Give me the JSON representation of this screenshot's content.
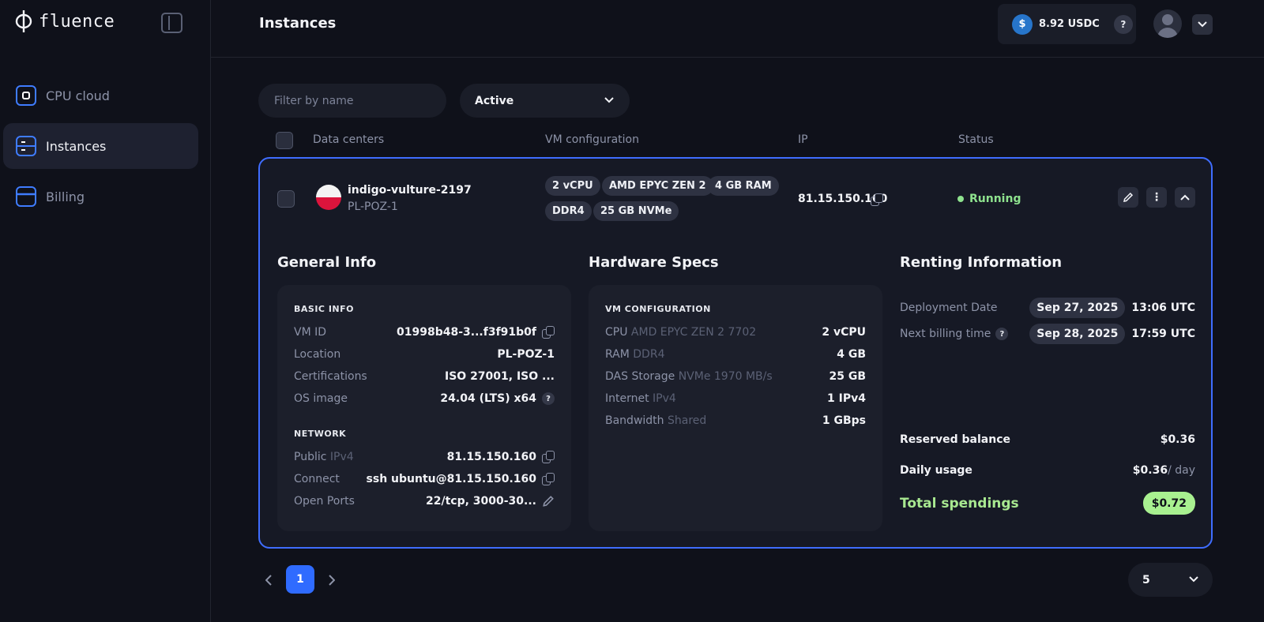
{
  "brand": {
    "name": "fluence"
  },
  "sidebar": {
    "items": [
      {
        "label": "CPU cloud",
        "icon": "cpu-icon",
        "active": false
      },
      {
        "label": "Instances",
        "icon": "server-icon",
        "active": true
      },
      {
        "label": "Billing",
        "icon": "card-icon",
        "active": false
      }
    ]
  },
  "header": {
    "title": "Instances",
    "balance": "8.92 USDC",
    "balance_icon": "usdc-icon",
    "help": "?"
  },
  "filters": {
    "name_placeholder": "Filter by name",
    "status_value": "Active"
  },
  "table": {
    "columns": [
      "Data centers",
      "VM configuration",
      "IP",
      "Status"
    ]
  },
  "instance": {
    "name": "indigo-vulture-2197",
    "location": "PL-POZ-1",
    "tags": [
      "2 vCPU",
      "AMD EPYC ZEN 2",
      "4 GB RAM",
      "DDR4",
      "25 GB NVMe"
    ],
    "ip": "81.15.150.160",
    "status": "Running",
    "accent_color": "#3f6dff",
    "status_color": "#8ee28e"
  },
  "general_info": {
    "title": "General Info",
    "basic_label": "BASIC INFO",
    "vm_id_k": "VM ID",
    "vm_id_v": "01998b48-3...f3f91b0f",
    "location_k": "Location",
    "location_v": "PL-POZ-1",
    "cert_k": "Certifications",
    "cert_v": "ISO 27001, ISO ...",
    "os_k": "OS image",
    "os_v": "24.04 (LTS) x64",
    "network_label": "NETWORK",
    "public_k": "Public",
    "public_sub": "IPv4",
    "public_v": "81.15.150.160",
    "connect_k": "Connect",
    "connect_v": "ssh ubuntu@81.15.150.160",
    "ports_k": "Open Ports",
    "ports_v": "22/tcp, 3000-30..."
  },
  "hardware": {
    "title": "Hardware Specs",
    "label": "VM CONFIGURATION",
    "rows": [
      {
        "k": "CPU",
        "sub": "AMD EPYC ZEN 2 7702",
        "v": "2 vCPU"
      },
      {
        "k": "RAM",
        "sub": "DDR4",
        "v": "4 GB"
      },
      {
        "k": "DAS Storage",
        "sub": "NVMe 1970 MB/s",
        "v": "25 GB"
      },
      {
        "k": "Internet",
        "sub": "IPv4",
        "v": "1 IPv4"
      },
      {
        "k": "Bandwidth",
        "sub": "Shared",
        "v": "1 GBps"
      }
    ]
  },
  "renting": {
    "title": "Renting Information",
    "deploy_k": "Deployment Date",
    "deploy_date": "Sep 27, 2025",
    "deploy_time": "13:06 UTC",
    "billing_k": "Next billing time",
    "billing_date": "Sep 28, 2025",
    "billing_time": "17:59 UTC",
    "reserved_k": "Reserved balance",
    "reserved_v": "$0.36",
    "daily_k": "Daily usage",
    "daily_v": "$0.36",
    "daily_unit": "/ day",
    "total_k": "Total spendings",
    "total_v": "$0.72"
  },
  "pagination": {
    "current": "1",
    "per_page": "5"
  }
}
